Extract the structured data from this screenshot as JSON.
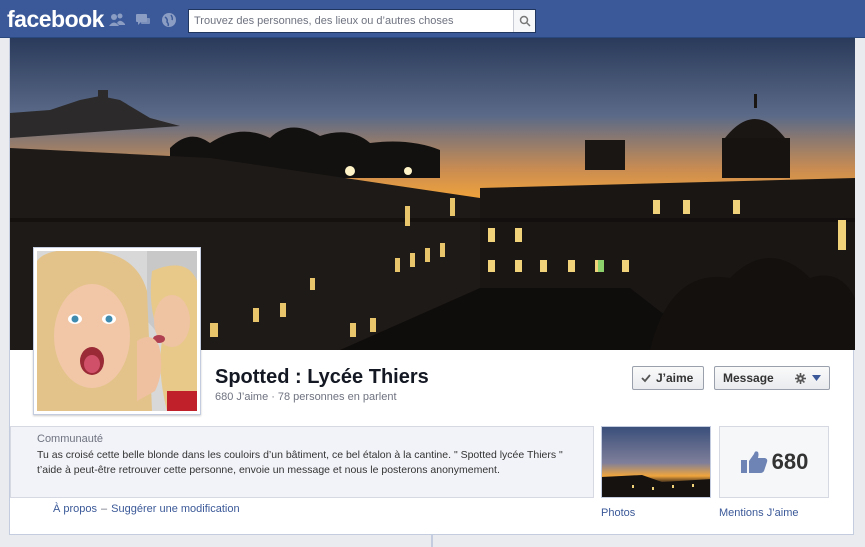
{
  "topbar": {
    "logo": "facebook",
    "search_placeholder": "Trouvez des personnes, des lieux ou d’autres choses",
    "icons": [
      "friends-icon",
      "messages-icon",
      "notifications-icon",
      "search-icon"
    ]
  },
  "page": {
    "name": "Spotted : Lycée Thiers",
    "likes_text": "680 J’aime",
    "talking_text": "78 personnes en parlent",
    "like_button": "J’aime",
    "message_button": "Message"
  },
  "about": {
    "category": "Communauté",
    "description": "Tu as croisé cette belle blonde dans les couloirs d’un bâtiment, ce bel étalon à la cantine. \" Spotted lycée Thiers \" t’aide à peut-être retrouver cette personne, envoie un message et nous le posterons anonymement.",
    "link_about": "À propos",
    "link_separator": "–",
    "link_suggest": "Suggérer une modification"
  },
  "apps": {
    "photos_label": "Photos",
    "likes_count": "680",
    "likes_label": "Mentions J’aime"
  },
  "colors": {
    "brand": "#3b5998",
    "sky_top": "#1d2a44",
    "sunset": "#f2a43a"
  }
}
